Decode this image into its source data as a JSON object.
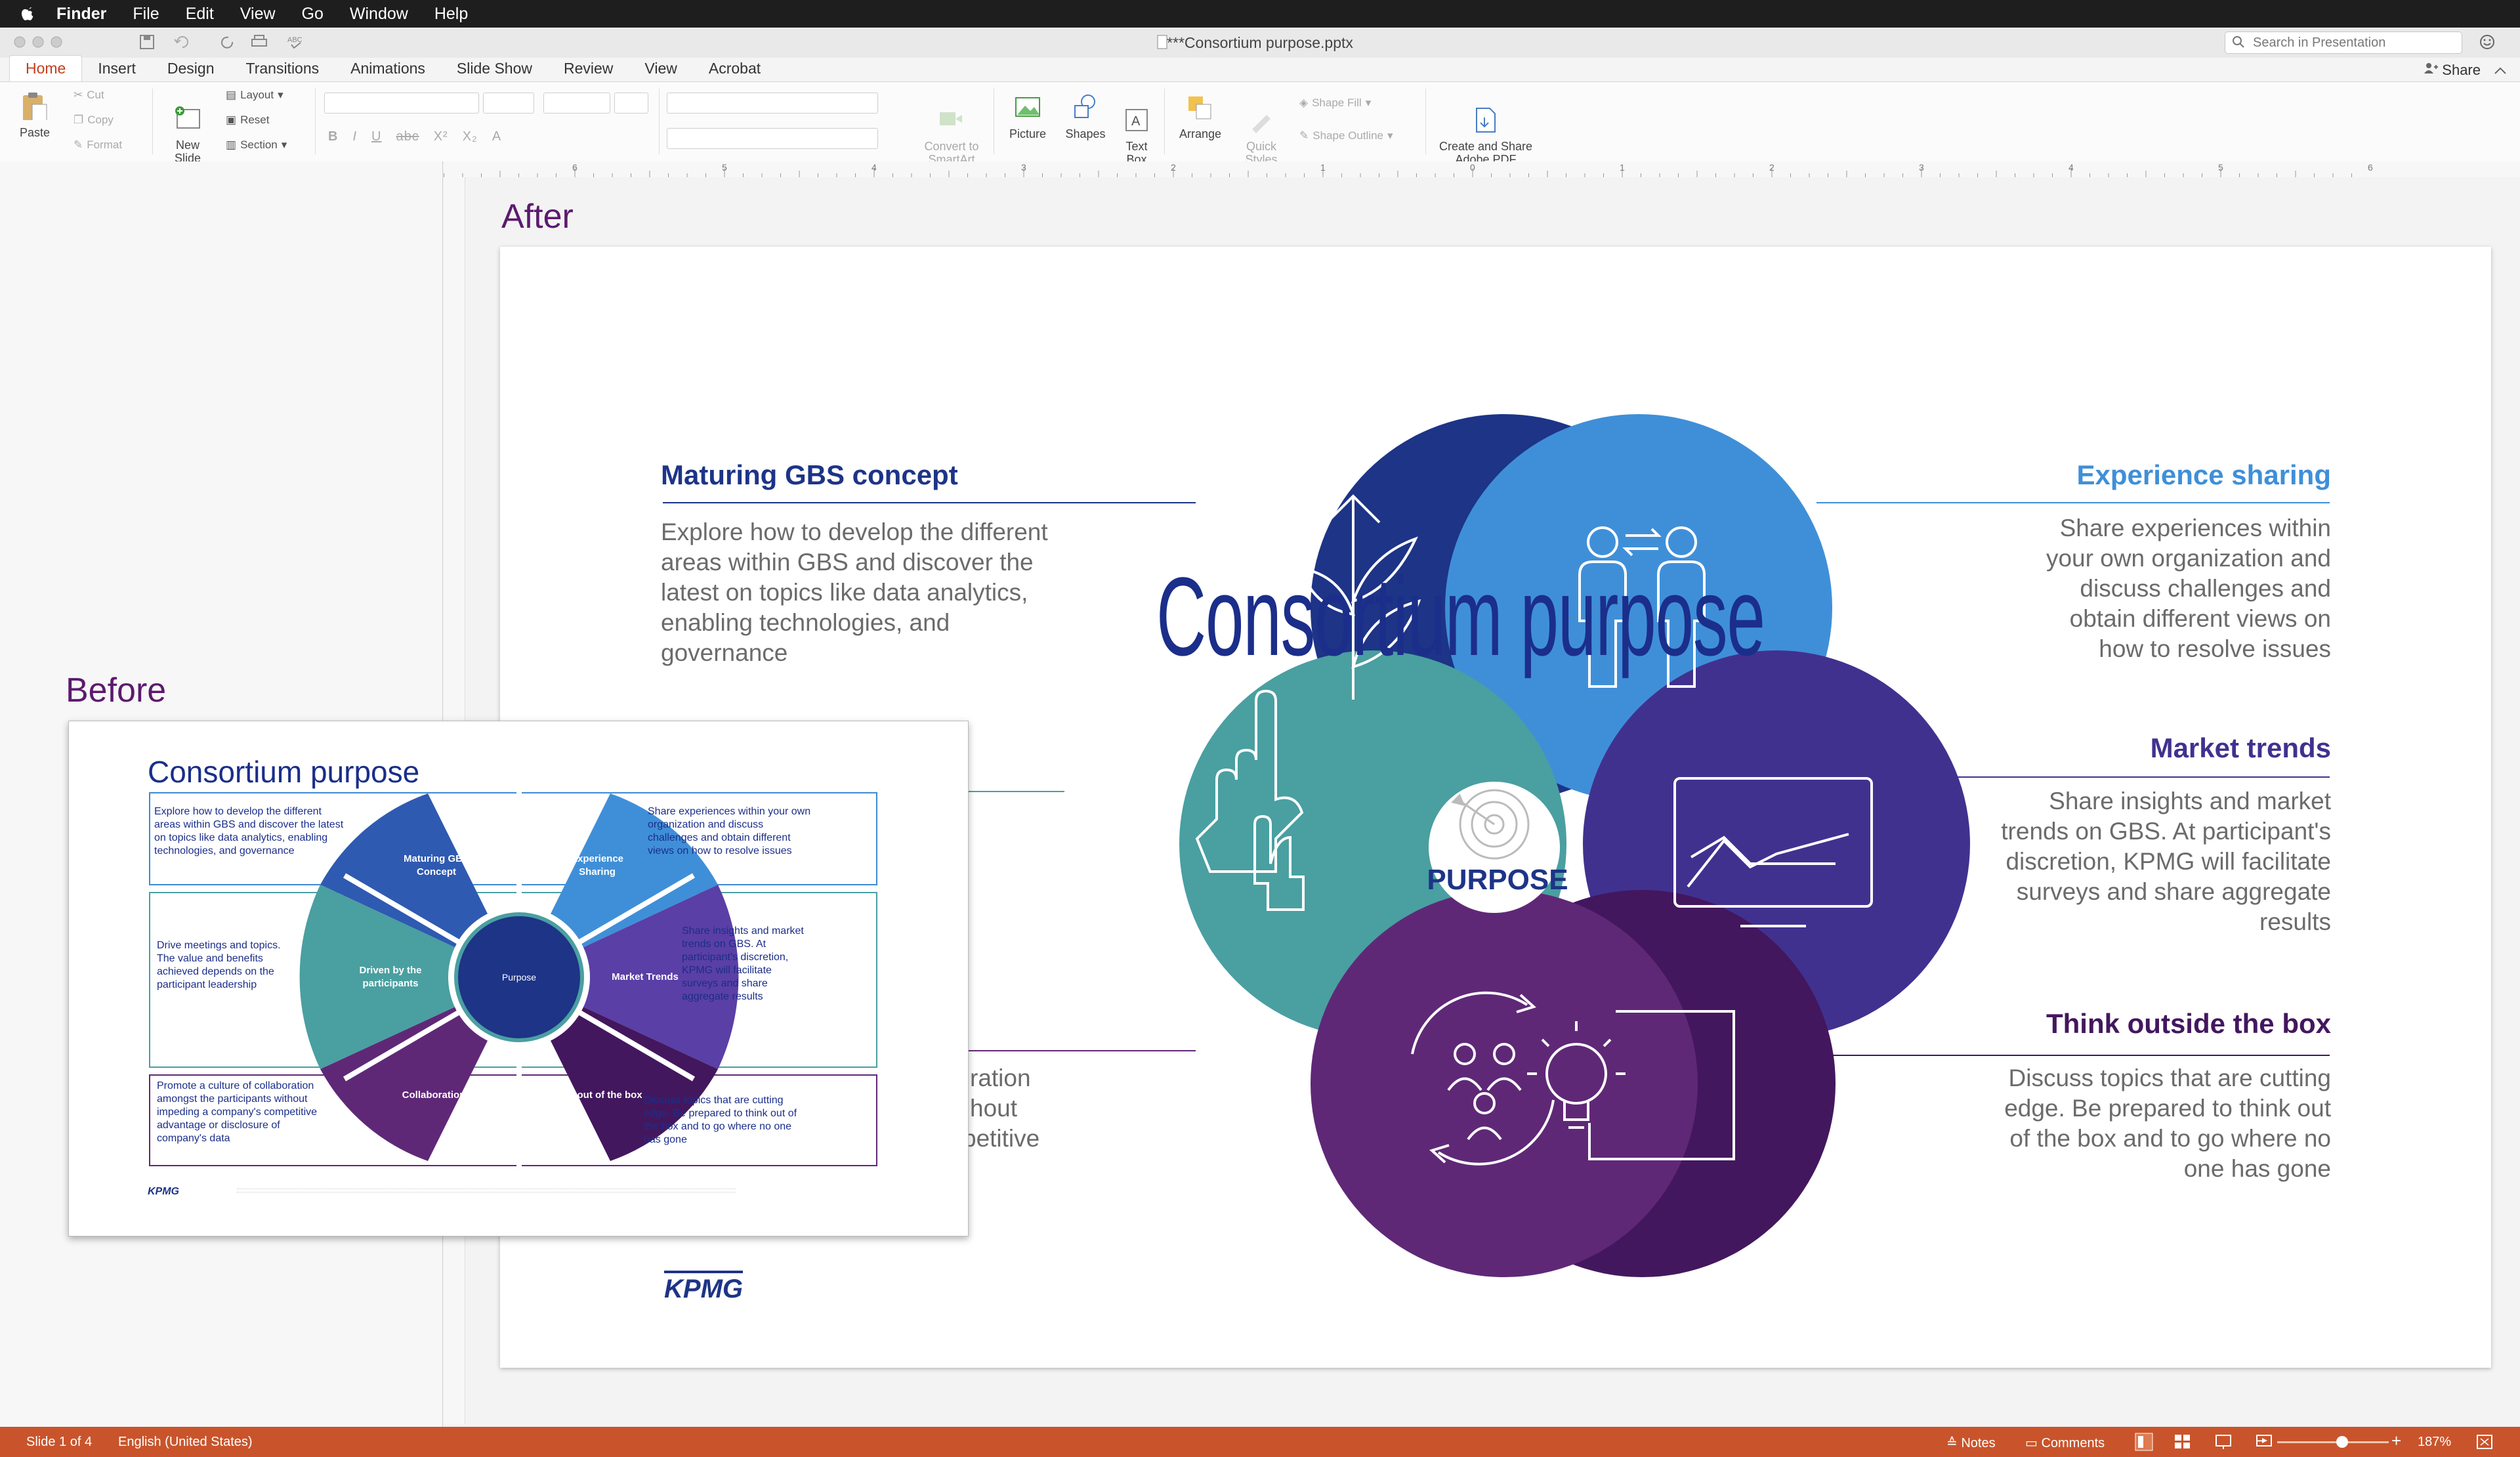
{
  "menubar": {
    "app": "Finder",
    "items": [
      "File",
      "Edit",
      "View",
      "Go",
      "Window",
      "Help"
    ]
  },
  "titlebar": {
    "document": "***Consortium purpose.pptx",
    "search_placeholder": "Search in Presentation"
  },
  "ribbon_tabs": [
    "Home",
    "Insert",
    "Design",
    "Transitions",
    "Animations",
    "Slide Show",
    "Review",
    "View",
    "Acrobat"
  ],
  "share_label": "Share",
  "ribbon": {
    "paste": "Paste",
    "cut": "Cut",
    "copy": "Copy",
    "format": "Format",
    "new_slide": "New\nSlide",
    "layout": "Layout",
    "reset": "Reset",
    "section": "Section",
    "convert": "Convert to\nSmartArt",
    "picture": "Picture",
    "shapes": "Shapes",
    "textbox": "Text\nBox",
    "arrange": "Arrange",
    "quick_styles": "Quick\nStyles",
    "shape_fill": "Shape Fill",
    "shape_outline": "Shape Outline",
    "adobe": "Create and Share\nAdobe PDF"
  },
  "ruler_labels": [
    "6",
    "5",
    "4",
    "3",
    "2",
    "1",
    "0",
    "1",
    "2",
    "3",
    "4",
    "5",
    "6"
  ],
  "labels": {
    "after": "After",
    "before": "Before"
  },
  "after_slide": {
    "title": "Consortium purpose",
    "center": "PURPOSE",
    "brand": "KPMG",
    "sections": {
      "maturing": {
        "heading": "Maturing GBS concept",
        "body": "Explore how to develop the different areas within GBS and discover the latest on topics like data analytics, enabling technologies, and governance"
      },
      "experience": {
        "heading": "Experience sharing",
        "body": "Share experiences within your own organization and discuss challenges and obtain different views on how to resolve issues"
      },
      "market": {
        "heading": "Market trends",
        "body": "Share insights and market trends on GBS. At participant's discretion, KPMG will facilitate surveys and share aggregate results"
      },
      "think": {
        "heading": "Think outside the box",
        "body": "Discuss topics that are cutting edge. Be prepared to think out of the box and to go where no one has gone"
      },
      "collab_partial": [
        "ration",
        "hout",
        "petitive"
      ]
    },
    "colors": {
      "navy": "#1d3487",
      "blue": "#3f8fd8",
      "teal": "#4a9fa1",
      "indigo": "#41318f",
      "purple": "#5f2877",
      "deep_purple": "#43175e"
    }
  },
  "before_slide": {
    "title": "Consortium purpose",
    "segments": [
      "Maturing GBS Concept",
      "Experience Sharing",
      "Market Trends",
      "Think out of the box",
      "Collaboration",
      "Driven by the participants"
    ],
    "center": "Purpose",
    "texts": {
      "maturing": "Explore how to develop the different areas within GBS and discover the latest on topics like data analytics, enabling technologies, and governance",
      "experience": "Share experiences within your own organization and discuss challenges and obtain different views on how to resolve issues",
      "driven": "Drive meetings and topics. The value and benefits achieved depends on the participant leadership",
      "market": "Share insights and market trends on GBS. At participant's discretion, KPMG will facilitate surveys and share aggregate results",
      "collab": "Promote a culture of collaboration amongst the participants without impeding a company's competitive advantage or disclosure of company's data",
      "think": "Discuss topics that are cutting edge. Be prepared to think out of the box and to go where no one has gone"
    },
    "brand": "KPMG"
  },
  "status": {
    "slide": "Slide 1 of 4",
    "language": "English (United States)",
    "notes": "Notes",
    "comments": "Comments",
    "zoom": "187%"
  }
}
